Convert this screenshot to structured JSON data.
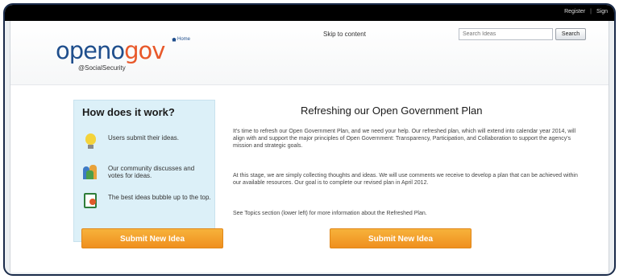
{
  "topbar": {
    "register": "Register",
    "separator": "|",
    "sign_in": "Sign"
  },
  "logo": {
    "open": "openo",
    "gov": "gov",
    "sub": "@SocialSecurity"
  },
  "header": {
    "home_link": "Home",
    "skip_link": "Skip to content"
  },
  "search": {
    "placeholder": "Search Ideas",
    "button": "Search"
  },
  "how_it_works": {
    "title": "How does it work?",
    "steps": [
      {
        "icon": "lightbulb-icon",
        "text": "Users submit their ideas."
      },
      {
        "icon": "community-icon",
        "text": "Our community discusses and votes for ideas."
      },
      {
        "icon": "checklist-icon",
        "text": "The best ideas bubble up to the top."
      }
    ],
    "submit_button": "Submit New Idea"
  },
  "main": {
    "title": "Refreshing our Open Government Plan",
    "paragraphs": [
      "It's time to refresh our Open Government Plan, and we need your help. Our refreshed plan, which will extend into calendar year 2014, will align with and support the major principles of Open Government: Transparency, Participation, and Collaboration to support the agency's mission and strategic goals.",
      "At this stage, we are simply collecting thoughts and ideas. We will use comments we receive to develop a plan that can be achieved within our available resources. Our goal is to complete our revised plan in April 2012.",
      "See Topics section (lower left) for more information about the Refreshed Plan."
    ],
    "submit_button": "Submit New Idea"
  },
  "colors": {
    "accent_orange": "#ef8f1e",
    "brand_blue": "#1f4e8c",
    "brand_orange": "#e8582a",
    "panel_bg": "#dcf0f8"
  }
}
